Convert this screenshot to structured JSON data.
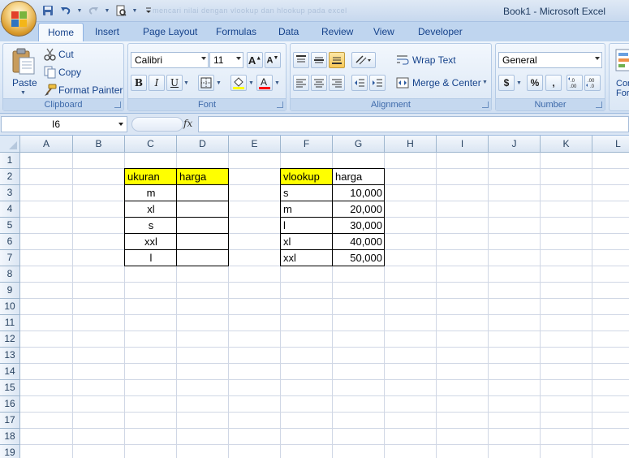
{
  "window": {
    "title": "Book1 - Microsoft Excel",
    "blurred_title": "mencari nilai dengan vlookup dan hlookup pada excel"
  },
  "tabs": [
    "Home",
    "Insert",
    "Page Layout",
    "Formulas",
    "Data",
    "Review",
    "View",
    "Developer"
  ],
  "active_tab": "Home",
  "clipboard": {
    "label": "Clipboard",
    "paste": "Paste",
    "cut": "Cut",
    "copy": "Copy",
    "format_painter": "Format Painter"
  },
  "font": {
    "label": "Font",
    "name": "Calibri",
    "size": "11",
    "font_color": "#ff0000",
    "fill_color": "#ffff00"
  },
  "alignment": {
    "label": "Alignment",
    "wrap_text": "Wrap Text",
    "merge_center": "Merge & Center"
  },
  "number": {
    "label": "Number",
    "format": "General",
    "currency": "$",
    "percent": "%",
    "comma": ",",
    "inc_decimal": "+.0\n.00",
    "dec_decimal": ".00\n→.0"
  },
  "cells_group": {
    "label": "Cond Form"
  },
  "formula_bar": {
    "name_box": "I6",
    "fx": "fx",
    "formula": ""
  },
  "columns": [
    "A",
    "B",
    "C",
    "D",
    "E",
    "F",
    "G",
    "H",
    "I",
    "J",
    "K",
    "L"
  ],
  "rows": [
    "1",
    "2",
    "3",
    "4",
    "5",
    "6",
    "7",
    "8",
    "9",
    "10",
    "11",
    "12",
    "13",
    "14",
    "15",
    "16",
    "17",
    "18",
    "19"
  ],
  "table1": {
    "headers": [
      "ukuran",
      "harga"
    ],
    "rows": [
      [
        "m",
        ""
      ],
      [
        "xl",
        ""
      ],
      [
        "s",
        ""
      ],
      [
        "xxl",
        ""
      ],
      [
        "l",
        ""
      ]
    ]
  },
  "table2": {
    "headers": [
      "vlookup",
      "harga"
    ],
    "rows": [
      [
        "s",
        "10,000"
      ],
      [
        "m",
        "20,000"
      ],
      [
        "l",
        "30,000"
      ],
      [
        "xl",
        "40,000"
      ],
      [
        "xxl",
        "50,000"
      ]
    ]
  },
  "colors": {
    "header_fill": "#ffff00",
    "ribbon_text": "#15428b",
    "grid_line": "#d0d7e5"
  }
}
